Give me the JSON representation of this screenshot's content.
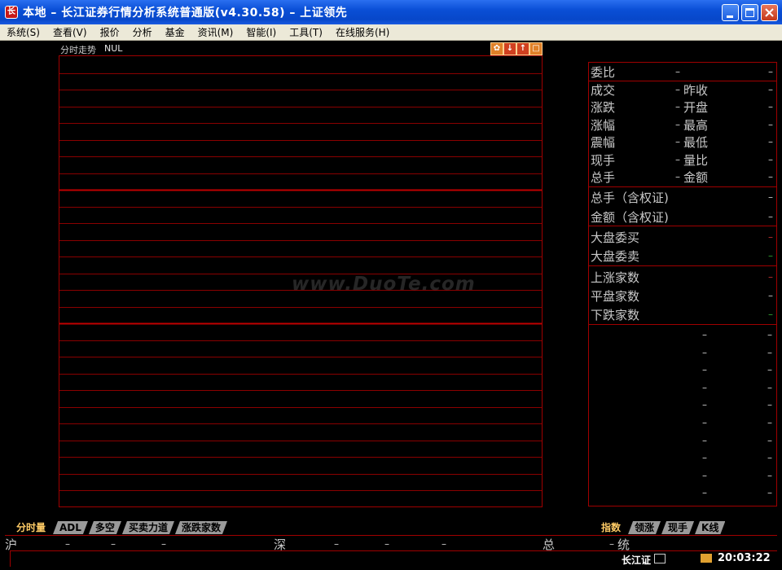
{
  "window": {
    "title": "本地 – 长江证券行情分析系统普通版(v4.30.58) – 上证领先",
    "icon": "app-logo-icon"
  },
  "menu": [
    "系统(S)",
    "查看(V)",
    "报价",
    "分析",
    "基金",
    "资讯(M)",
    "智能(I)",
    "工具(T)",
    "在线服务(H)"
  ],
  "chart": {
    "title": "分时走势",
    "code": "NUL",
    "tools": [
      "settings-icon",
      "arrow-down-icon",
      "arrow-up-icon",
      "expand-icon"
    ],
    "tabs": [
      "分时量",
      "ADL",
      "多空",
      "买卖力道",
      "涨跌家数"
    ],
    "active_tab": "分时量"
  },
  "quote_panel": {
    "weibi": {
      "label": "委比",
      "value": "–"
    },
    "rows": [
      {
        "l1": "成交",
        "v1": "–",
        "l2": "昨收",
        "v2": "–"
      },
      {
        "l1": "涨跌",
        "v1": "–",
        "l2": "开盘",
        "v2": "–"
      },
      {
        "l1": "涨幅",
        "v1": "–",
        "l2": "最高",
        "v2": "–"
      },
      {
        "l1": "震幅",
        "v1": "–",
        "l2": "最低",
        "v2": "–"
      },
      {
        "l1": "现手",
        "v1": "–",
        "l2": "量比",
        "v2": "–"
      },
      {
        "l1": "总手",
        "v1": "–",
        "l2": "金额",
        "v2": "–"
      }
    ],
    "totals": [
      {
        "label": "总手（含权证)",
        "value": "–"
      },
      {
        "label": "金额（含权证)",
        "value": "–"
      }
    ],
    "orders": [
      {
        "label": "大盘委买",
        "value": "–"
      },
      {
        "label": "大盘委卖",
        "value": "–"
      }
    ],
    "breadth": [
      {
        "label": "上涨家数",
        "value": "–"
      },
      {
        "label": "平盘家数",
        "value": "–"
      },
      {
        "label": "下跌家数",
        "value": "–"
      }
    ],
    "tabs": [
      "指数",
      "领涨",
      "现手",
      "K线"
    ],
    "active_tab": "指数"
  },
  "status": {
    "sh_label": "沪",
    "sz_label": "深",
    "total_label": "总",
    "stat_label": "统",
    "dash": "–",
    "broker": "长江证",
    "time": "20:03:22"
  },
  "watermark": "www.DuoTe.com"
}
